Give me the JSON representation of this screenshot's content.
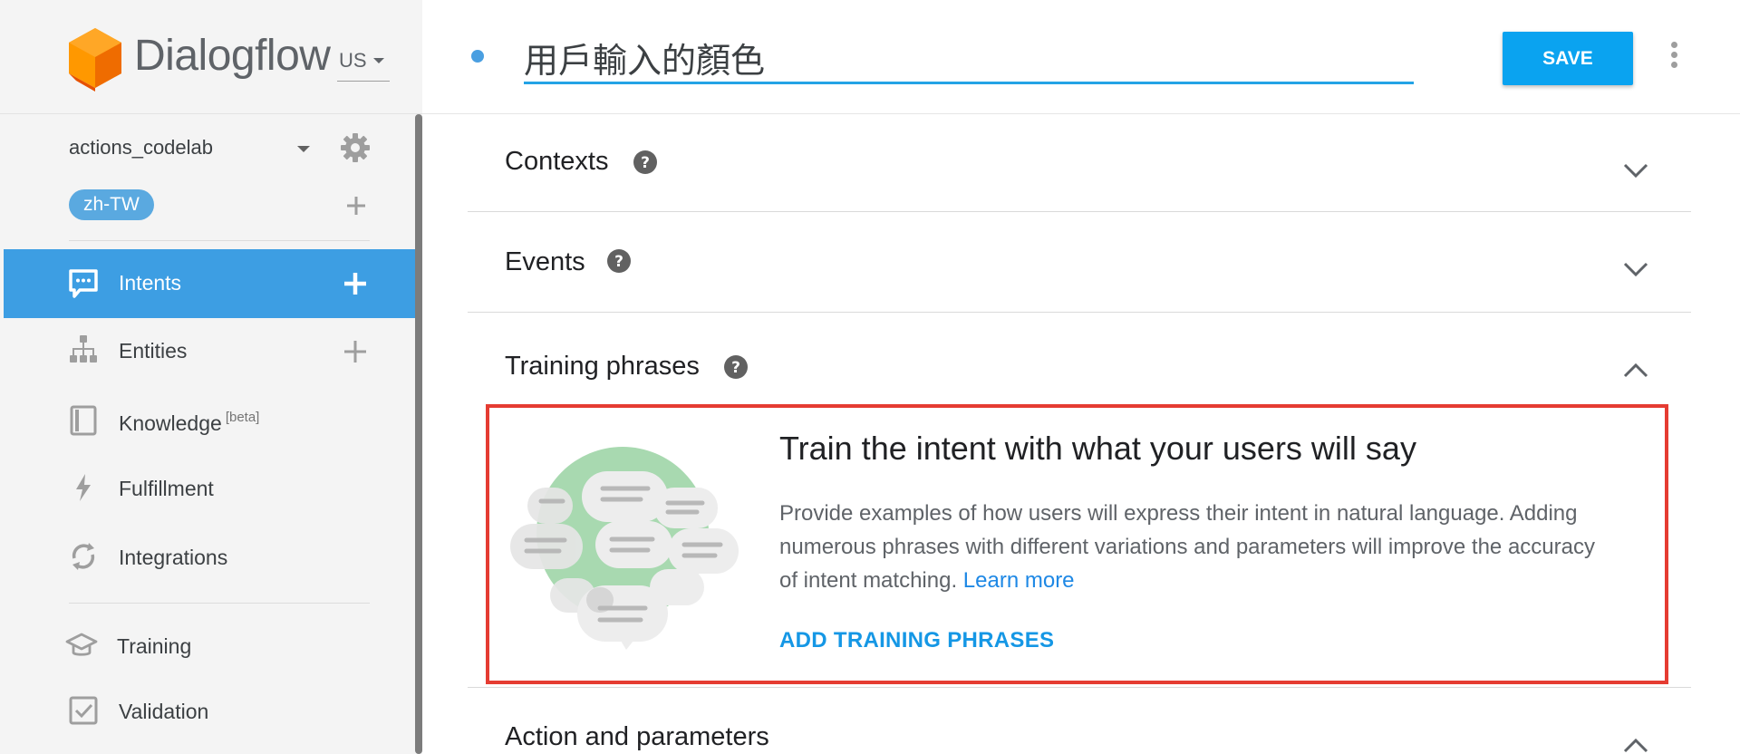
{
  "app": {
    "name": "Dialogflow",
    "region": "US",
    "agent": "actions_codelab",
    "language": "zh-TW"
  },
  "sidebar": {
    "items": [
      {
        "label": "Intents",
        "icon": "chat-bubble-icon",
        "active": true,
        "has_add": true
      },
      {
        "label": "Entities",
        "icon": "hierarchy-icon",
        "active": false,
        "has_add": true
      },
      {
        "label": "Knowledge",
        "badge": "[beta]",
        "icon": "book-icon",
        "active": false
      },
      {
        "label": "Fulfillment",
        "icon": "lightning-icon",
        "active": false
      },
      {
        "label": "Integrations",
        "icon": "sync-icon",
        "active": false
      },
      {
        "label": "Training",
        "icon": "graduation-cap-icon",
        "active": false
      },
      {
        "label": "Validation",
        "icon": "check-box-icon",
        "active": false
      }
    ]
  },
  "header": {
    "intent_name": "用戶輸入的顏色",
    "save_label": "SAVE"
  },
  "sections": {
    "contexts": "Contexts",
    "events": "Events",
    "training_phrases": "Training phrases",
    "action_parameters": "Action and parameters"
  },
  "training_card": {
    "heading": "Train the intent with what your users will say",
    "description": "Provide examples of how users will express their intent in natural language. Adding numerous phrases with different variations and parameters will improve the accuracy of intent matching.",
    "learn_more": "Learn more",
    "add_button": "ADD TRAINING PHRASES"
  },
  "colors": {
    "accent": "#3d9ee3",
    "save_button": "#0aa3f0",
    "highlight_border": "#e53c32",
    "logo": "#f57c00"
  }
}
